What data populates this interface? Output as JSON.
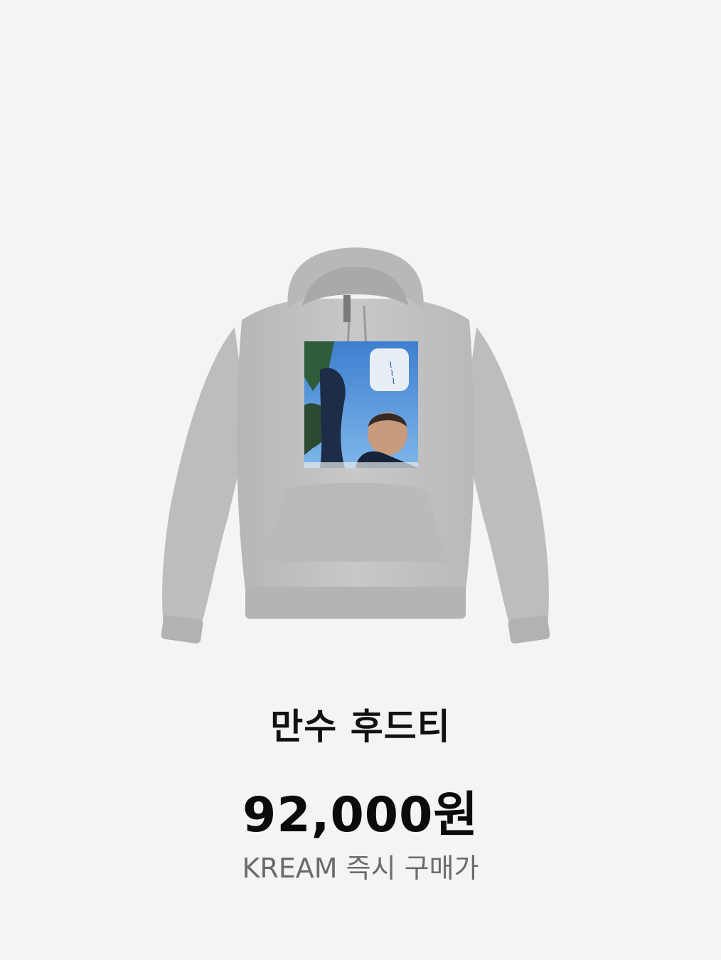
{
  "product": {
    "name": "만수 후드티",
    "price": "92,000원",
    "price_caption": "KREAM 즉시 구매가",
    "image_icon": "hoodie-product-image"
  },
  "colors": {
    "background": "#f4f4f4",
    "hoodie": "#c4c4c4",
    "title": "#111111",
    "caption": "#6b6b6b"
  }
}
